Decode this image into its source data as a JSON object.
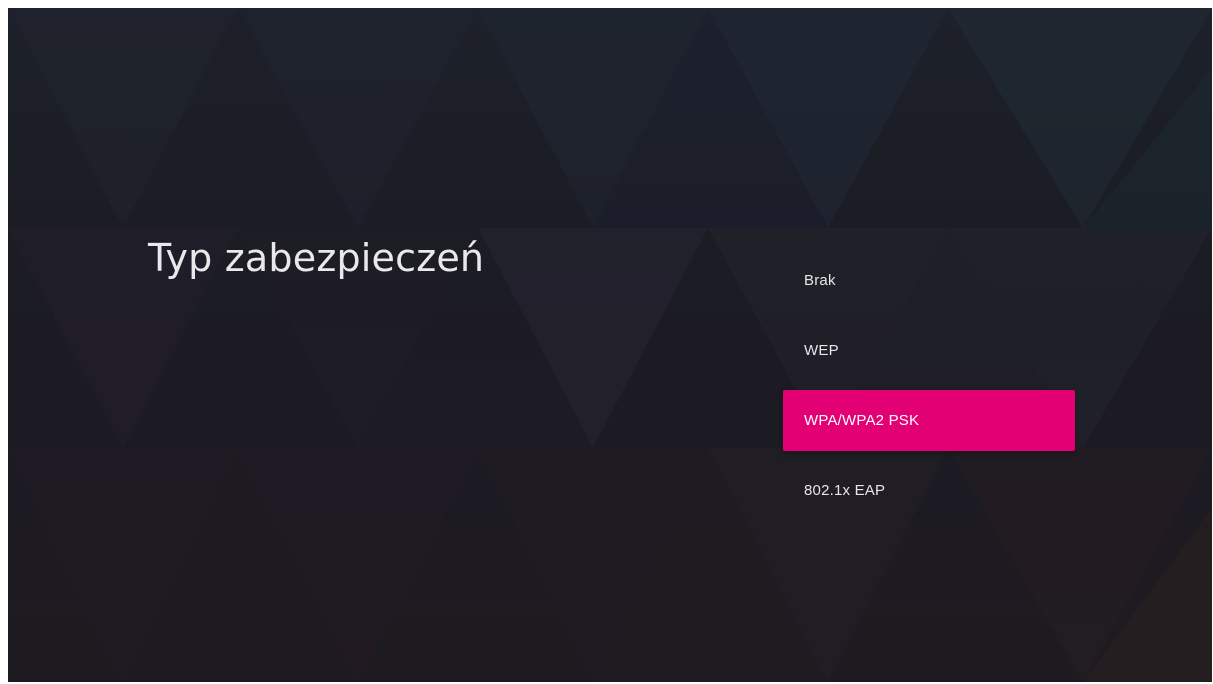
{
  "screen": {
    "title": "Typ zabezpieczeń"
  },
  "options": [
    {
      "label": "Brak",
      "selected": false
    },
    {
      "label": "WEP",
      "selected": false
    },
    {
      "label": "WPA/WPA2 PSK",
      "selected": true
    },
    {
      "label": "802.1x EAP",
      "selected": false
    }
  ],
  "colors": {
    "accent": "#e20074",
    "background": "#1c1c24",
    "text": "#e9e9ec"
  }
}
